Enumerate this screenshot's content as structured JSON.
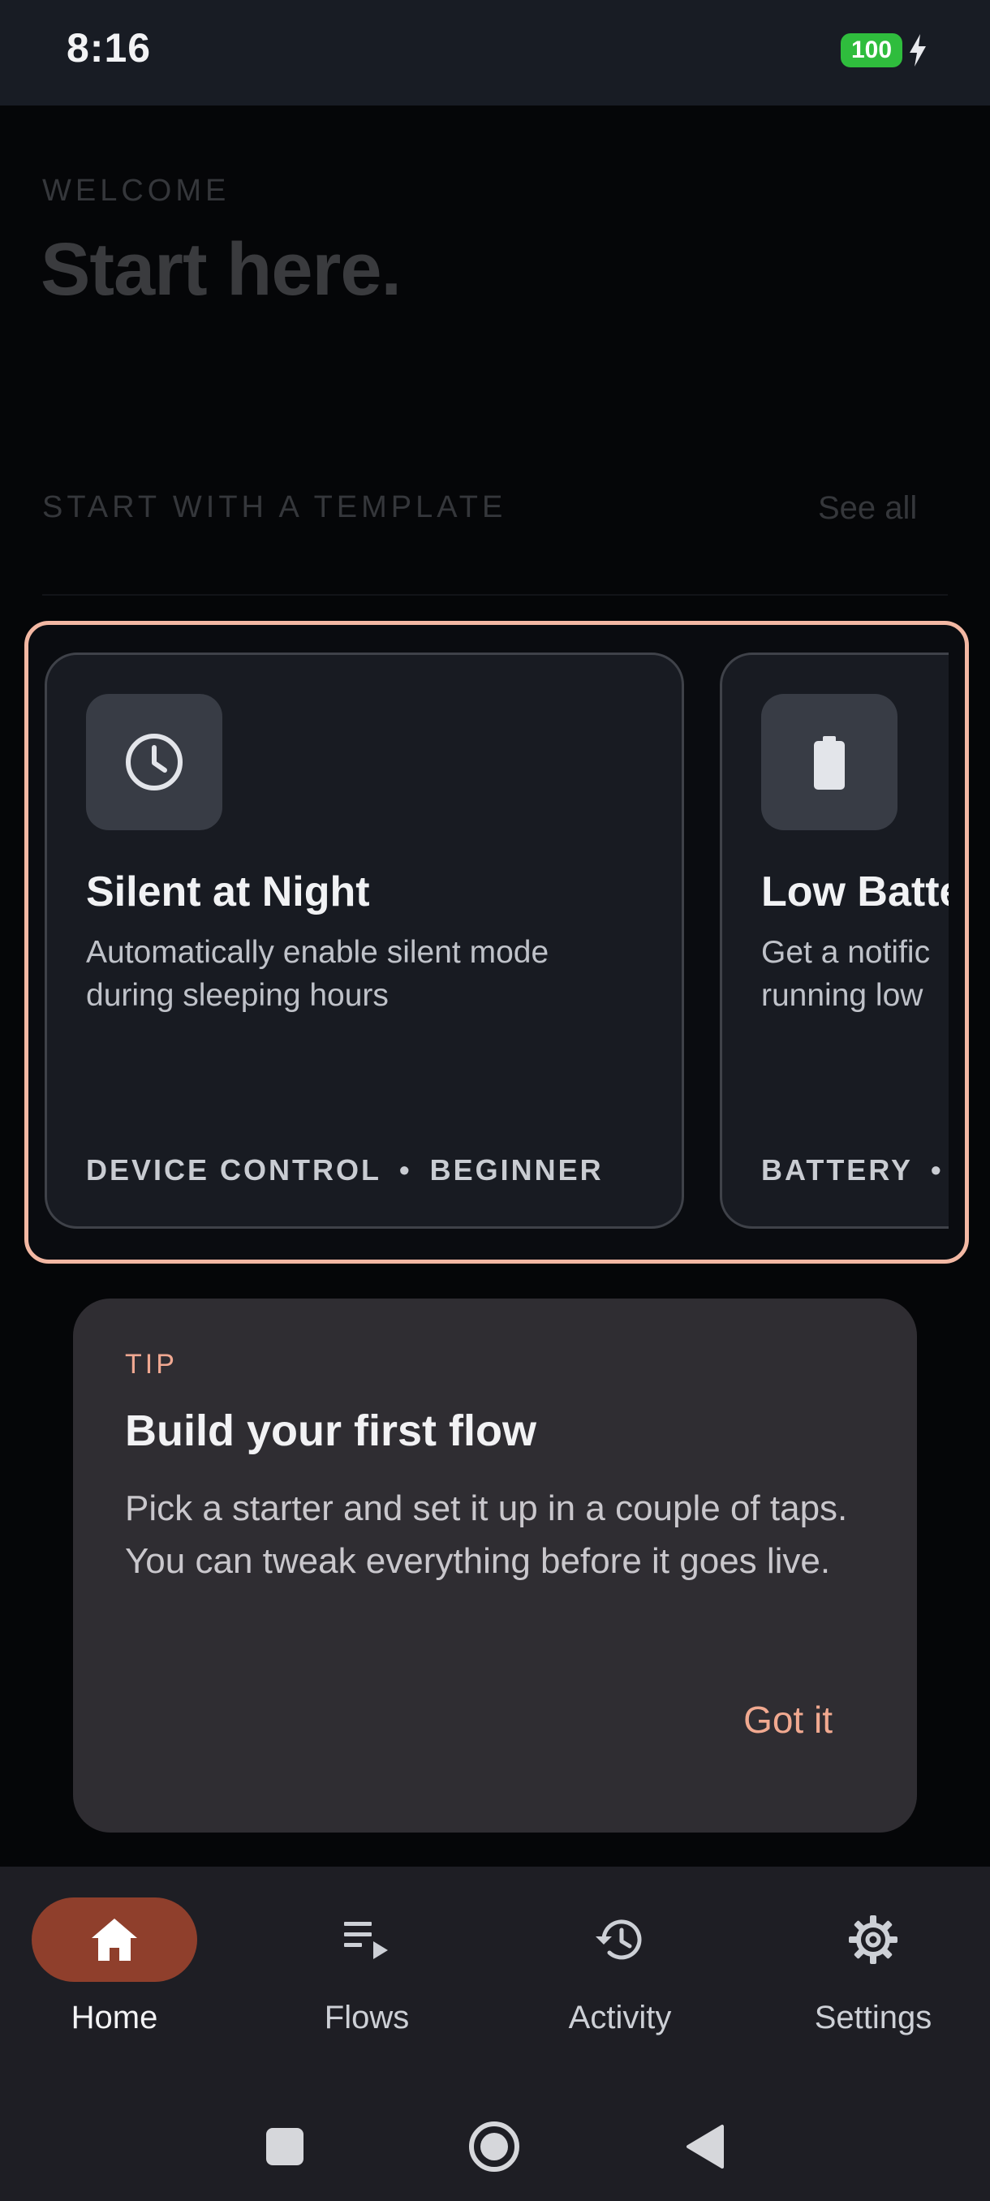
{
  "status_bar": {
    "time": "8:16",
    "battery_level": "100"
  },
  "header": {
    "eyebrow": "WELCOME",
    "title": "Start here."
  },
  "templates_section": {
    "label": "START WITH A TEMPLATE",
    "see_all": "See all",
    "cards": [
      {
        "icon": "clock-icon",
        "title": "Silent at Night",
        "description": "Automatically enable silent mode during sleeping hours",
        "category": "DEVICE CONTROL",
        "level": "BEGINNER"
      },
      {
        "icon": "battery-icon",
        "title": "Low Batte",
        "description": "Get a notific running low",
        "category": "BATTERY",
        "level": ""
      }
    ]
  },
  "tip": {
    "label": "TIP",
    "title": "Build your first flow",
    "body": "Pick a starter and set it up in a couple of taps. You can tweak everything before it goes live.",
    "action": "Got it"
  },
  "bottom_nav": {
    "items": [
      {
        "label": "Home",
        "icon": "home-icon",
        "active": true
      },
      {
        "label": "Flows",
        "icon": "playlist-icon",
        "active": false
      },
      {
        "label": "Activity",
        "icon": "history-icon",
        "active": false
      },
      {
        "label": "Settings",
        "icon": "gear-icon",
        "active": false
      }
    ]
  },
  "colors": {
    "accent": "#f1a990",
    "highlight_border": "#f3b8a3",
    "active_pill": "#8f3f2c",
    "battery_green": "#2fbd3d"
  }
}
